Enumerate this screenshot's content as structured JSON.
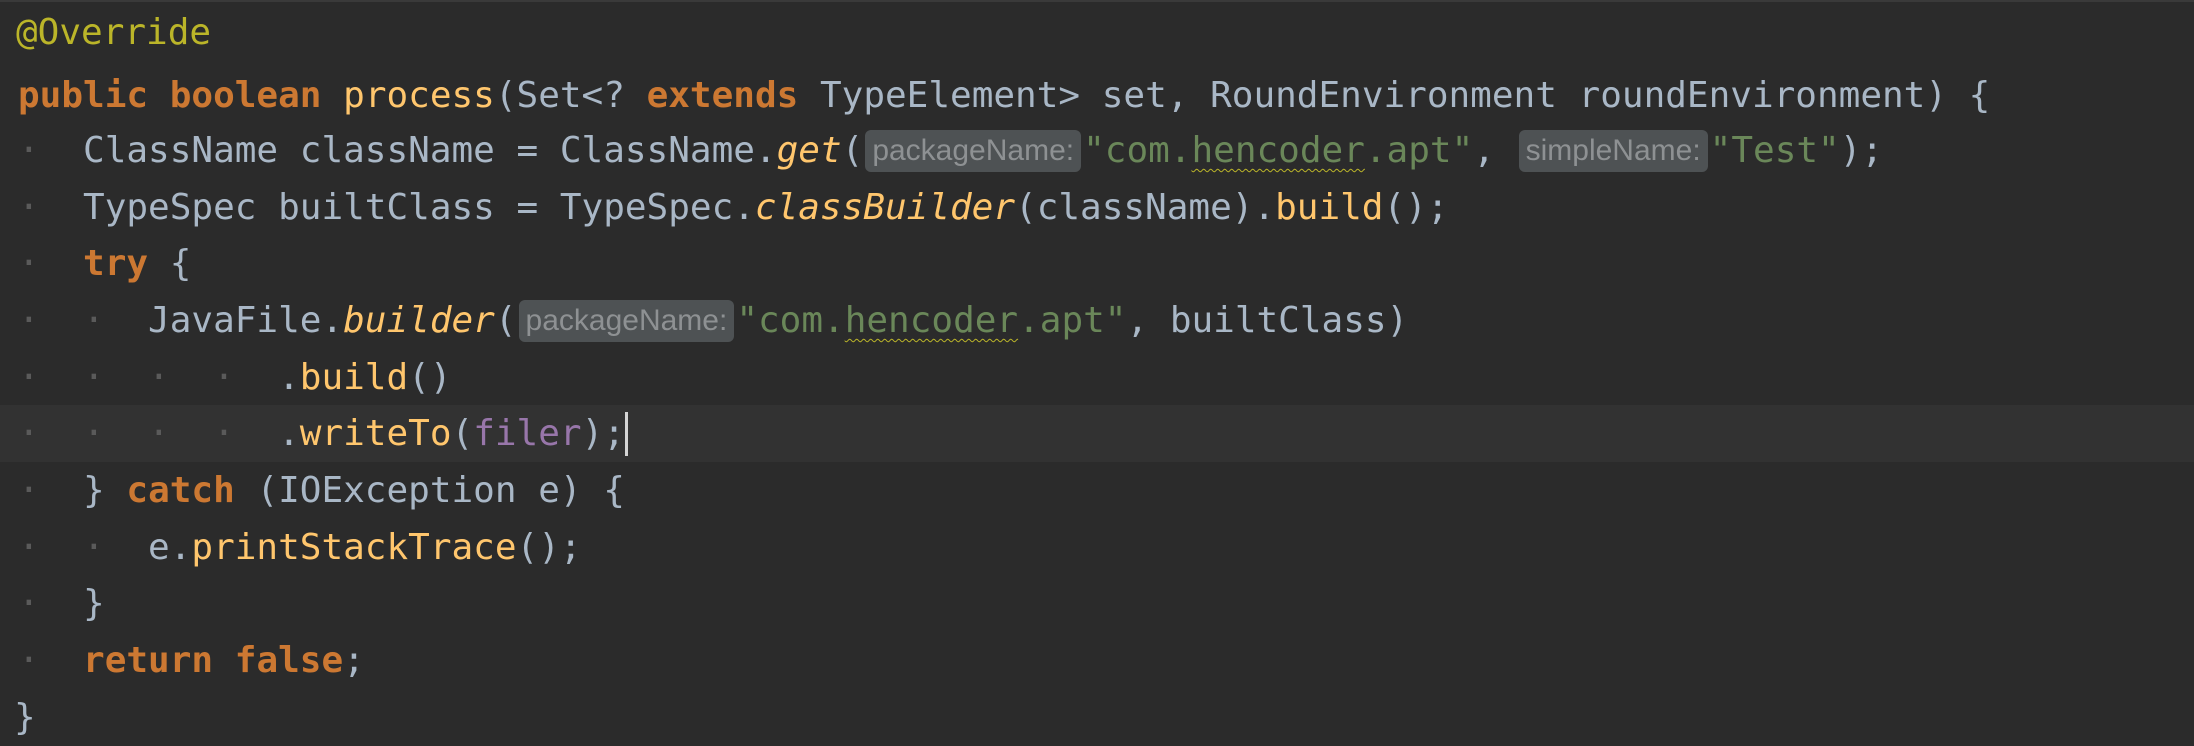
{
  "code": {
    "l1": {
      "annotation": "@Override"
    },
    "l2": {
      "kw_public": "public",
      "kw_boolean": "boolean",
      "method": "process",
      "open": "(Set<? ",
      "kw_extends": "extends",
      "params": " TypeElement> set, RoundEnvironment roundEnvironment) {"
    },
    "l3": {
      "a": "ClassName className = ClassName.",
      "get": "get",
      "paren": "(",
      "hint1": "packageName:",
      "str1_open": "\"com.",
      "str1_squig": "hencoder",
      "str1_close": ".apt\"",
      "comma": ", ",
      "hint2": "simpleName:",
      "str2": "\"Test\"",
      "end": ");"
    },
    "l4": {
      "a": "TypeSpec builtClass = TypeSpec.",
      "classBuilder": "classBuilder",
      "b": "(className).",
      "build": "build",
      "end": "();"
    },
    "l5": {
      "kw_try": "try",
      "end": " {"
    },
    "l6": {
      "a": "JavaFile.",
      "builder": "builder",
      "paren": "(",
      "hint1": "packageName:",
      "str_open": "\"com.",
      "str_squig": "hencoder",
      "str_close": ".apt\"",
      "end": ", builtClass)"
    },
    "l7": {
      "dot": ".",
      "build": "build",
      "end": "()"
    },
    "l8": {
      "dot": ".",
      "writeTo": "writeTo",
      "paren": "(",
      "filer": "filer",
      "end": ");"
    },
    "l9": {
      "a": "} ",
      "kw_catch": "catch",
      "b": " (IOException e) {"
    },
    "l10": {
      "a": "e.",
      "printStackTrace": "printStackTrace",
      "end": "();"
    },
    "l11": {
      "brace": "}"
    },
    "l12": {
      "kw_return": "return",
      "sp": " ",
      "kw_false": "false",
      "end": ";"
    },
    "l13": {
      "brace": "}"
    }
  },
  "colors": {
    "background": "#2b2b2b",
    "keyword": "#cc7832",
    "method": "#ffc66d",
    "string": "#6a8759",
    "annotation": "#bbb529",
    "field": "#9876aa",
    "plain": "#a9b7c6"
  }
}
